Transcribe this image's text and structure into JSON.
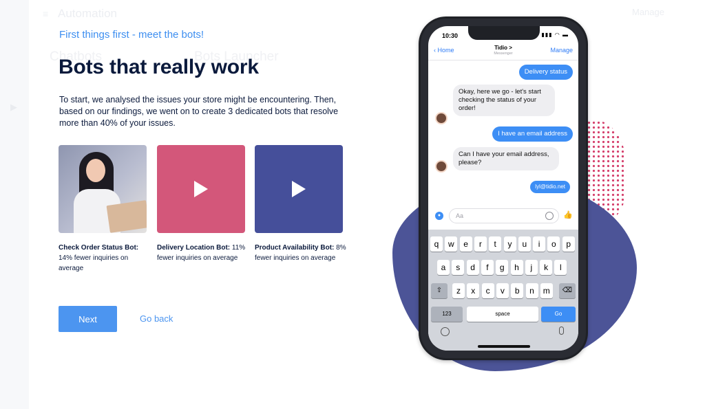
{
  "background": {
    "app_title": "Automation",
    "tab1": "Chatbots",
    "tab2": "Bots Launcher",
    "manage": "Manage"
  },
  "intro": {
    "subtitle": "First things first - meet the bots!",
    "heading": "Bots that really work",
    "description": "To start, we analysed the issues your store might be encountering. Then, based on our findings, we went on to create 3 dedicated bots that resolve more than 40% of your issues."
  },
  "bots": [
    {
      "name": "Check Order Status Bot:",
      "detail": " 14% fewer inquiries on average",
      "color": "#8f96b0"
    },
    {
      "name": "Delivery Location Bot:",
      "detail": " 11% fewer inquiries on average",
      "color": "#d3577a"
    },
    {
      "name": "Product Availability Bot:",
      "detail": " 8% fewer inquiries on average",
      "color": "#454f9a"
    }
  ],
  "actions": {
    "next": "Next",
    "back": "Go back"
  },
  "phone": {
    "time": "10:30",
    "status_icons": "▮▮▮ ◠ ▬",
    "nav_back": "Home",
    "nav_title": "Tidio >",
    "nav_subtitle": "Messenger",
    "nav_manage": "Manage",
    "messages": [
      "Delivery status",
      "Okay, here we go - let's start checking the status of your order!",
      "I have an email address",
      "Can I have your email address, please?",
      "lyl@tidio.net"
    ],
    "composer_placeholder": "Aa",
    "keyboard": {
      "row1": [
        "q",
        "w",
        "e",
        "r",
        "t",
        "y",
        "u",
        "i",
        "o",
        "p"
      ],
      "row2": [
        "a",
        "s",
        "d",
        "f",
        "g",
        "h",
        "j",
        "k",
        "l"
      ],
      "row3": [
        "z",
        "x",
        "c",
        "v",
        "b",
        "n",
        "m"
      ],
      "shift": "⇧",
      "delete": "⌫",
      "numbers": "123",
      "space": "space",
      "go": "Go"
    }
  },
  "colors": {
    "accent": "#4c95f0",
    "blob": "#4c5497",
    "dots": "#d5406c"
  }
}
